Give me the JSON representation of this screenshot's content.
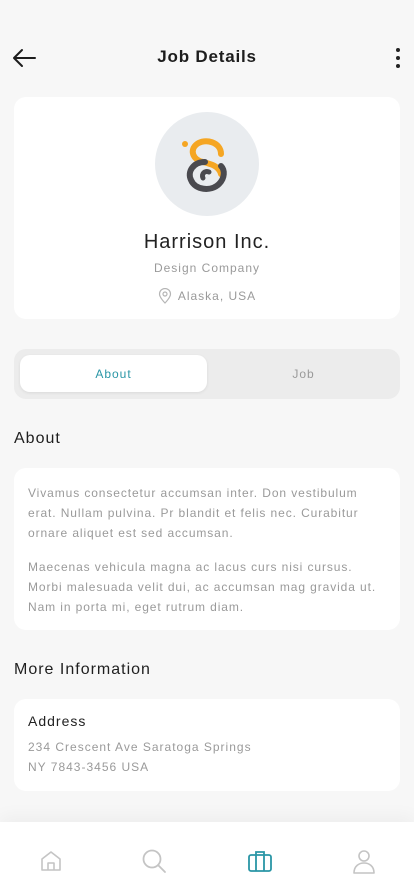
{
  "header": {
    "title": "Job Details"
  },
  "company": {
    "name": "Harrison Inc.",
    "type": "Design Company",
    "location": "Alaska, USA"
  },
  "tabs": [
    {
      "label": "About",
      "active": true
    },
    {
      "label": "Job",
      "active": false
    }
  ],
  "about": {
    "title": "About",
    "paragraphs": [
      "Vivamus consectetur accumsan inter. Don vestibulum erat. Nullam pulvina. Pr blandit et felis nec. Curabitur ornare aliquet est sed accumsan.",
      "Maecenas vehicula magna ac lacus curs nisi cursus. Morbi malesuada velit dui, ac accumsan mag gravida ut. Nam in porta mi, eget rutrum diam."
    ]
  },
  "more_info": {
    "title": "More Information",
    "address_label": "Address",
    "address_lines": [
      "234 Crescent Ave Saratoga Springs",
      "NY 7843-3456 USA"
    ]
  },
  "bottom_nav": [
    {
      "icon": "home-icon",
      "active": false
    },
    {
      "icon": "search-icon",
      "active": false
    },
    {
      "icon": "briefcase-icon",
      "active": true
    },
    {
      "icon": "profile-icon",
      "active": false
    }
  ],
  "colors": {
    "accent": "#2a96a6",
    "logo_orange": "#f5a623",
    "logo_dark": "#4a4a4f",
    "muted_text": "#9a9a9a",
    "background": "#f7f7f7"
  }
}
